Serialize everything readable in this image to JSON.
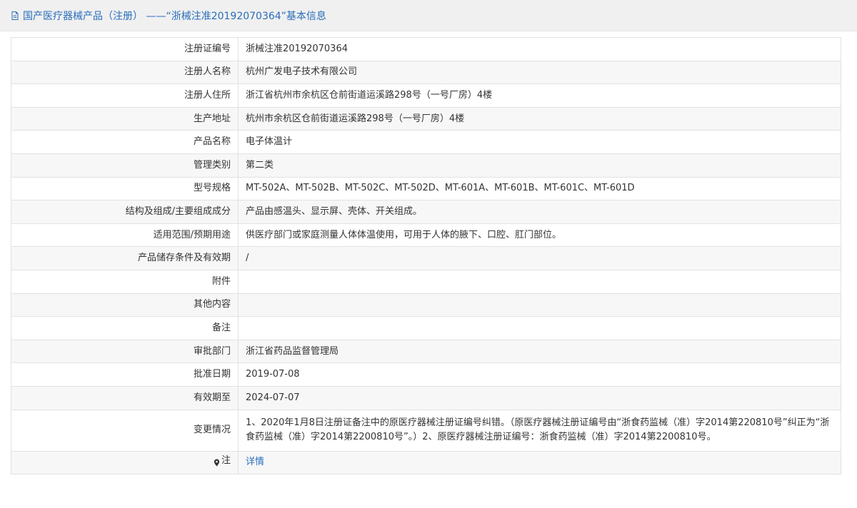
{
  "header": {
    "title": "国产医疗器械产品（注册） ——“浙械注准20192070364”基本信息"
  },
  "rows": [
    {
      "label": "注册证编号",
      "value": "浙械注准20192070364"
    },
    {
      "label": "注册人名称",
      "value": "杭州广发电子技术有限公司"
    },
    {
      "label": "注册人住所",
      "value": "浙江省杭州市余杭区仓前街道运溪路298号（一号厂房）4楼"
    },
    {
      "label": "生产地址",
      "value": "杭州市余杭区仓前街道运溪路298号（一号厂房）4楼"
    },
    {
      "label": "产品名称",
      "value": "电子体温计"
    },
    {
      "label": "管理类别",
      "value": "第二类"
    },
    {
      "label": "型号规格",
      "value": "MT-502A、MT-502B、MT-502C、MT-502D、MT-601A、MT-601B、MT-601C、MT-601D"
    },
    {
      "label": "结构及组成/主要组成成分",
      "value": "产品由感温头、显示屏、壳体、开关组成。"
    },
    {
      "label": "适用范围/预期用途",
      "value": "供医疗部门或家庭测量人体体温使用，可用于人体的腋下、口腔、肛门部位。"
    },
    {
      "label": "产品储存条件及有效期",
      "value": "/"
    },
    {
      "label": "附件",
      "value": ""
    },
    {
      "label": "其他内容",
      "value": ""
    },
    {
      "label": "备注",
      "value": ""
    },
    {
      "label": "审批部门",
      "value": "浙江省药品监督管理局"
    },
    {
      "label": "批准日期",
      "value": "2019-07-08"
    },
    {
      "label": "有效期至",
      "value": "2024-07-07"
    },
    {
      "label": "变更情况",
      "value": "1、2020年1月8日注册证备注中的原医疗器械注册证编号纠错。（原医疗器械注册证编号由“浙食药监械（准）字2014第220810号”纠正为“浙食药监械（准）字2014第2200810号”。）2、原医疗器械注册证编号：浙食药监械（准）字2014第2200810号。"
    }
  ],
  "note": {
    "label": "注",
    "link_text": "详情",
    "icon": "pin-icon"
  },
  "colors": {
    "accent": "#2a6ebb",
    "header_bg": "#f0f0f0",
    "row_alt_bg": "#f7f7f7"
  }
}
